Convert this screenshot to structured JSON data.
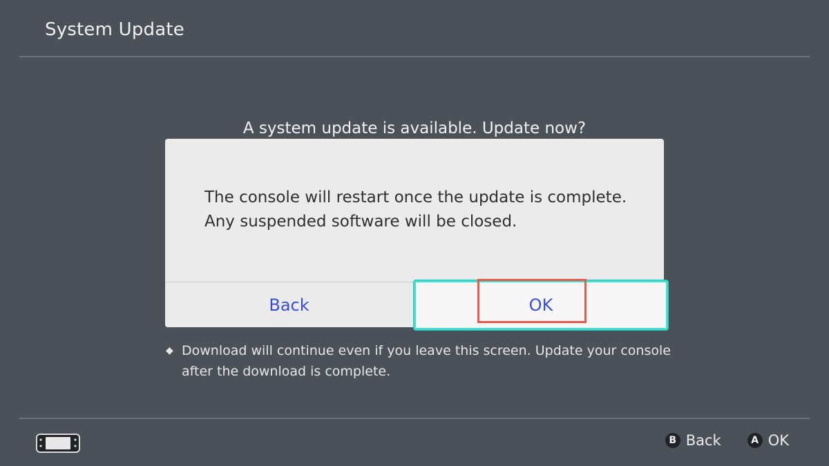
{
  "header": {
    "title": "System Update"
  },
  "background": {
    "question": "A system update is available. Update now?",
    "note_bullet": "◆",
    "note_line1": "Download will continue even if you leave this screen. Update your console",
    "note_line2": "after the download is complete."
  },
  "dialog": {
    "message_line1": "The console will restart once the update is complete.",
    "message_line2": "Any suspended software will be closed.",
    "back_label": "Back",
    "ok_label": "OK"
  },
  "footer": {
    "console_icon": "handheld-console-icon",
    "hints": [
      {
        "button": "B",
        "label": "Back"
      },
      {
        "button": "A",
        "label": "OK"
      }
    ]
  },
  "colors": {
    "background": "#4b5159",
    "dialog": "#ebebeb",
    "button_text": "#3a4fd0",
    "focus_border": "#3ee0d0",
    "annotation_box": "#e8574a"
  }
}
